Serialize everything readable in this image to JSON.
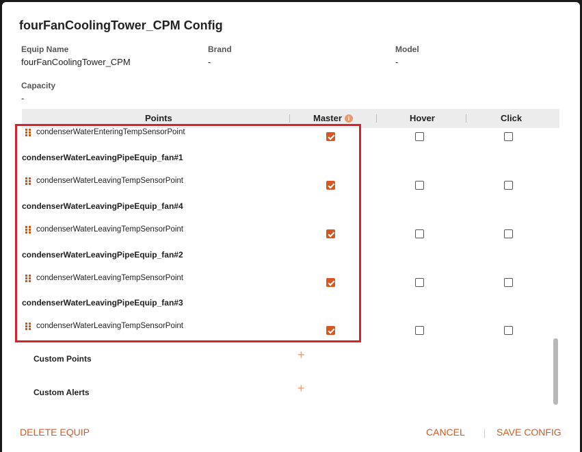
{
  "dialog": {
    "title": "fourFanCoolingTower_CPM Config"
  },
  "equip": {
    "name_label": "Equip Name",
    "name_value": "fourFanCoolingTower_CPM",
    "brand_label": "Brand",
    "brand_value": "-",
    "model_label": "Model",
    "model_value": "-",
    "capacity_label": "Capacity",
    "capacity_value": "-"
  },
  "table": {
    "columns": {
      "points": "Points",
      "master": "Master",
      "hover": "Hover",
      "click": "Click"
    },
    "master_info_icon": "i"
  },
  "rows": {
    "r0": {
      "label": "condenserWaterEnteringTempSensorPoint",
      "master": true,
      "hover": false,
      "click": false
    },
    "g1": "condenserWaterLeavingPipeEquip_fan#1",
    "r1": {
      "label": "condenserWaterLeavingTempSensorPoint",
      "master": true,
      "hover": false,
      "click": false
    },
    "g4": "condenserWaterLeavingPipeEquip_fan#4",
    "r4": {
      "label": "condenserWaterLeavingTempSensorPoint",
      "master": true,
      "hover": false,
      "click": false
    },
    "g2": "condenserWaterLeavingPipeEquip_fan#2",
    "r2": {
      "label": "condenserWaterLeavingTempSensorPoint",
      "master": true,
      "hover": false,
      "click": false
    },
    "g3": "condenserWaterLeavingPipeEquip_fan#3",
    "r3": {
      "label": "condenserWaterLeavingTempSensorPoint",
      "master": true,
      "hover": false,
      "click": false
    }
  },
  "sections": {
    "custom_points": "Custom Points",
    "custom_alerts": "Custom Alerts",
    "add_icon": "+"
  },
  "footer": {
    "delete": "DELETE EQUIP",
    "cancel": "CANCEL",
    "save": "SAVE CONFIG"
  },
  "colors": {
    "accent": "#d4581f",
    "highlight": "#d6222c",
    "header_bg": "#ececec"
  }
}
